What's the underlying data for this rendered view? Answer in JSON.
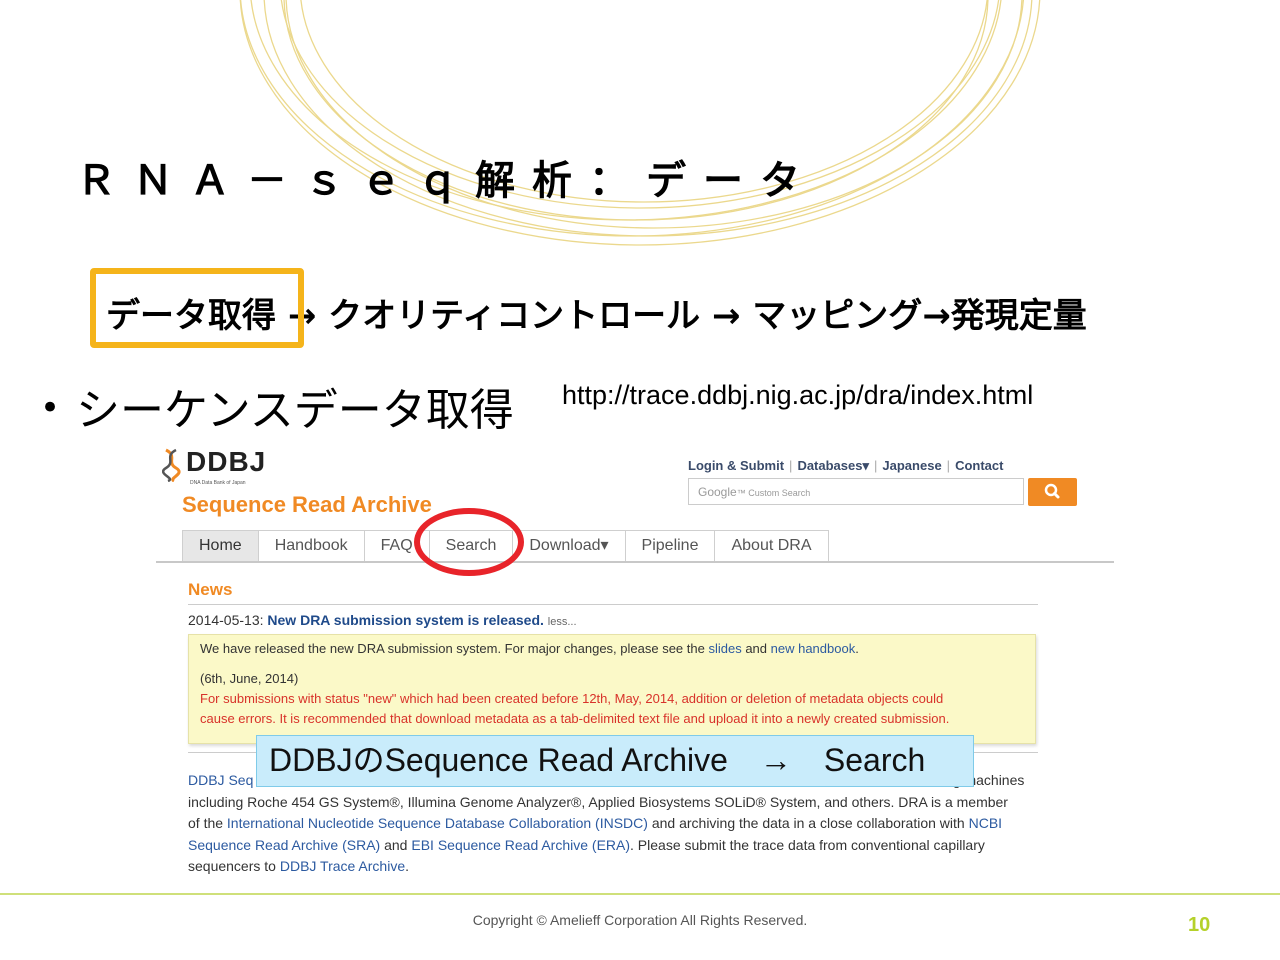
{
  "slide": {
    "title": "ＲＮＡ－ｓｅｑ解析：データ",
    "flow": {
      "step_current": "データ取得",
      "arrow1": " → ",
      "step2": "クオリティコントロール",
      "arrow2": " → ",
      "step3": "マッピング",
      "arrow3": "→",
      "step4": "発現定量"
    },
    "bullet": "シーケンスデータ取得",
    "url": "http://trace.ddbj.nig.ac.jp/dra/index.html",
    "callout": "DDBJのSequence Read Archive　→　Search",
    "copyright": "Copyright © Amelieff Corporation All Rights Reserved.",
    "page_number": "10",
    "colors": {
      "accent_box": "#f5b41a",
      "highlight_ring": "#e8242a",
      "callout_bg": "#c9ecfb",
      "page_number": "#b5d12a"
    }
  },
  "screenshot": {
    "logo_text": "DDBJ",
    "logo_subtitle": "DNA Data Bank of Japan",
    "top_links": [
      "Login & Submit",
      "Databases▾",
      "Japanese",
      "Contact"
    ],
    "search_placeholder_brand": "Google",
    "search_placeholder_text": "Custom Search",
    "search_icon": "magnifier-icon",
    "site_title": "Sequence Read Archive",
    "tabs": [
      "Home",
      "Handbook",
      "FAQ",
      "Search",
      "Download▾",
      "Pipeline",
      "About DRA"
    ],
    "news_heading": "News",
    "news": {
      "date": "2014-05-13:",
      "title": "New DRA submission system is released.",
      "less": "less...",
      "line1_pre": "We have released the new DRA submission system. For major changes, please see the ",
      "line1_link1": "slides",
      "line1_mid": " and ",
      "line1_link2": "new handbook",
      "line1_post": ".",
      "date2": "(6th, June, 2014)",
      "red1": "For submissions with status \"new\" which had been created before 12th, May, 2014, addition or deletion of metadata objects could",
      "red2": "cause errors. It is recommended that download metadata as a tab-delimited text file and upload it into a newly created submission."
    },
    "para": {
      "l1_link": "DDBJ Seq",
      "l1_tail": "ng machines",
      "l2": "including Roche 454 GS System®, Illumina Genome Analyzer®, Applied Biosystems SOLiD® System, and others. DRA is a member",
      "l3_pre": "of the ",
      "l3_link1": "International Nucleotide Sequence Database Collaboration (INSDC)",
      "l3_mid": " and archiving the data in a close collaboration with ",
      "l3_link2": "NCBI",
      "l4_link1": "Sequence Read Archive (SRA)",
      "l4_mid": " and ",
      "l4_link2": "EBI Sequence Read Archive (ERA)",
      "l4_post": ". Please submit the trace data from conventional capillary",
      "l5_pre": "sequencers to ",
      "l5_link": "DDBJ Trace Archive",
      "l5_post": "."
    }
  }
}
